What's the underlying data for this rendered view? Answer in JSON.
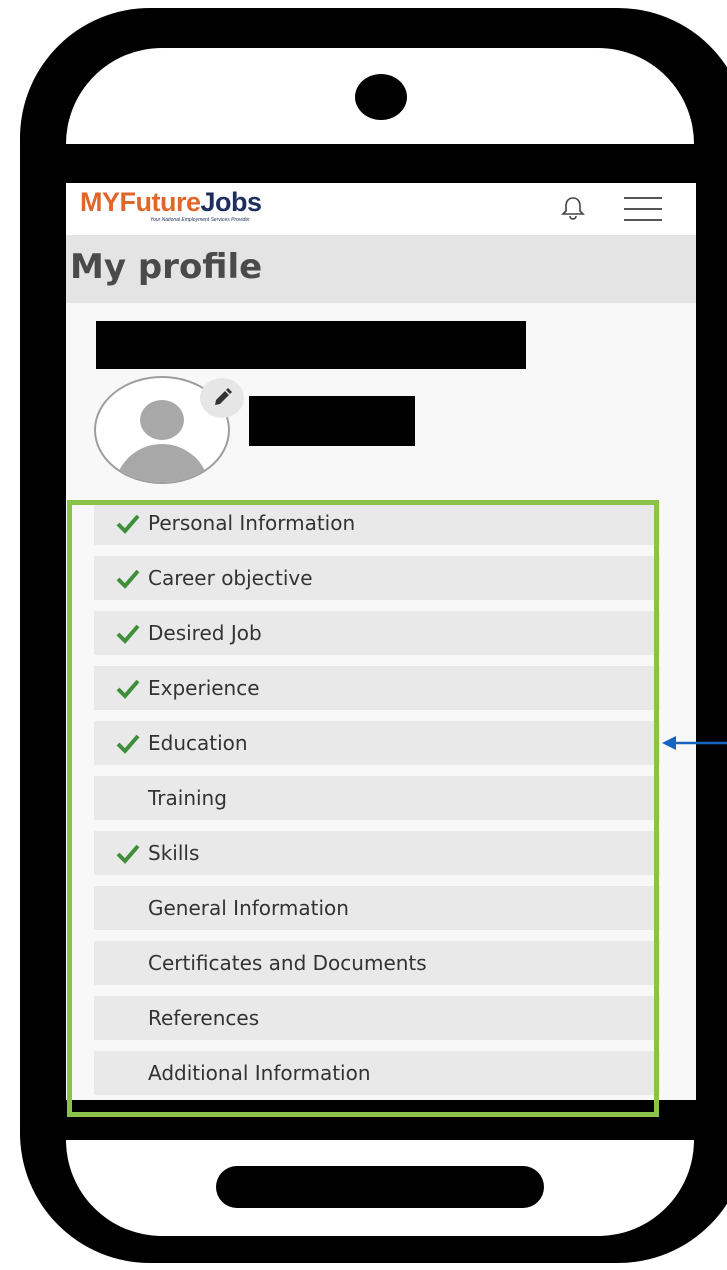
{
  "app": {
    "logo_my": "MY",
    "logo_future": "Future",
    "logo_jobs": "Jobs",
    "logo_tagline": "Your National Employment Services Provider"
  },
  "header": {
    "bell_icon": "bell-icon",
    "menu_icon": "hamburger-menu-icon"
  },
  "page": {
    "title": "My profile"
  },
  "profile": {
    "edit_icon": "pencil-icon"
  },
  "sections": [
    {
      "label": "Personal Information",
      "completed": true
    },
    {
      "label": "Career objective",
      "completed": true
    },
    {
      "label": "Desired Job",
      "completed": true
    },
    {
      "label": "Experience",
      "completed": true
    },
    {
      "label": "Education",
      "completed": true
    },
    {
      "label": "Training",
      "completed": false
    },
    {
      "label": "Skills",
      "completed": true
    },
    {
      "label": "General Information",
      "completed": false
    },
    {
      "label": "Certificates and Documents",
      "completed": false
    },
    {
      "label": "References",
      "completed": false
    },
    {
      "label": "Additional Information",
      "completed": false
    }
  ],
  "colors": {
    "check": "#3f8f3a",
    "highlight": "#8bc34a",
    "arrow": "#1565c0",
    "brand_orange": "#e0662a",
    "brand_navy": "#1f2e5c"
  }
}
